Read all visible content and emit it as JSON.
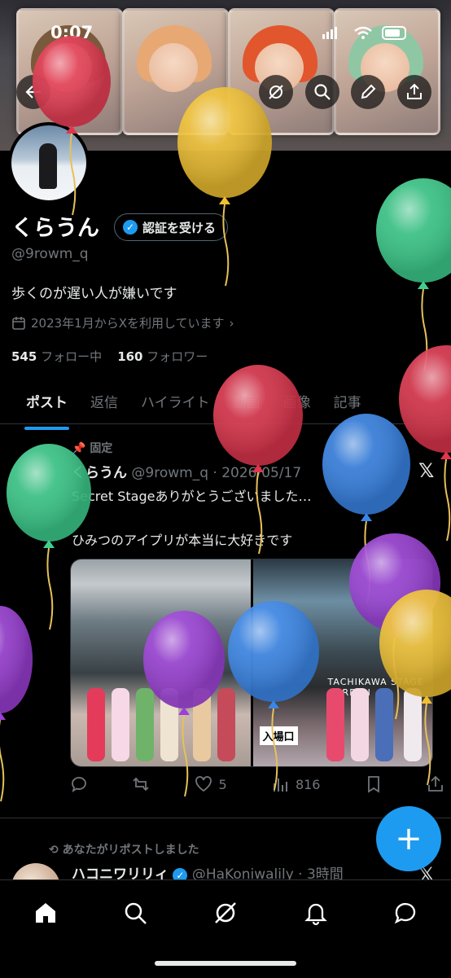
{
  "status": {
    "time": "0:07"
  },
  "profile": {
    "name": "くらうん",
    "verify_label": "認証を受ける",
    "handle": "@9rowm_q",
    "bio": "歩くのが遅い人が嫌いです",
    "joined": "2023年1月からXを利用しています",
    "following_count": "545",
    "following_label": "フォロー中",
    "followers_count": "160",
    "followers_label": "フォロワー"
  },
  "tabs": [
    {
      "label": "ポスト"
    },
    {
      "label": "返信"
    },
    {
      "label": "ハイライト"
    },
    {
      "label": "動画"
    },
    {
      "label": "画像"
    },
    {
      "label": "記事"
    }
  ],
  "pinned_post": {
    "pin_label": "固定",
    "author": "くらうん",
    "handle_date": "@9rowm_q · 2026/05/17",
    "line1": "Secret Stageありがとうございました…",
    "line2": "ひみつのアイプリが本当に大好きです",
    "media_entrance": "入場口",
    "media_sign": "TACHIKAWA STAGE GARDEN",
    "likes": "5",
    "views": "816"
  },
  "second_post": {
    "repost_note": "あなたがリポストしました",
    "author": "ハコニワリリィ",
    "handle_time": "@HaKoniwalily · 3時間"
  },
  "fab_label": "+",
  "x_logo": "𝕏",
  "colors": {
    "accent": "#1d9bf0",
    "balloon_red": "#e0354d",
    "balloon_yellow": "#f0c030",
    "balloon_green": "#3ecf8e",
    "balloon_blue": "#3a86e8",
    "balloon_purple": "#9b3fd6"
  }
}
